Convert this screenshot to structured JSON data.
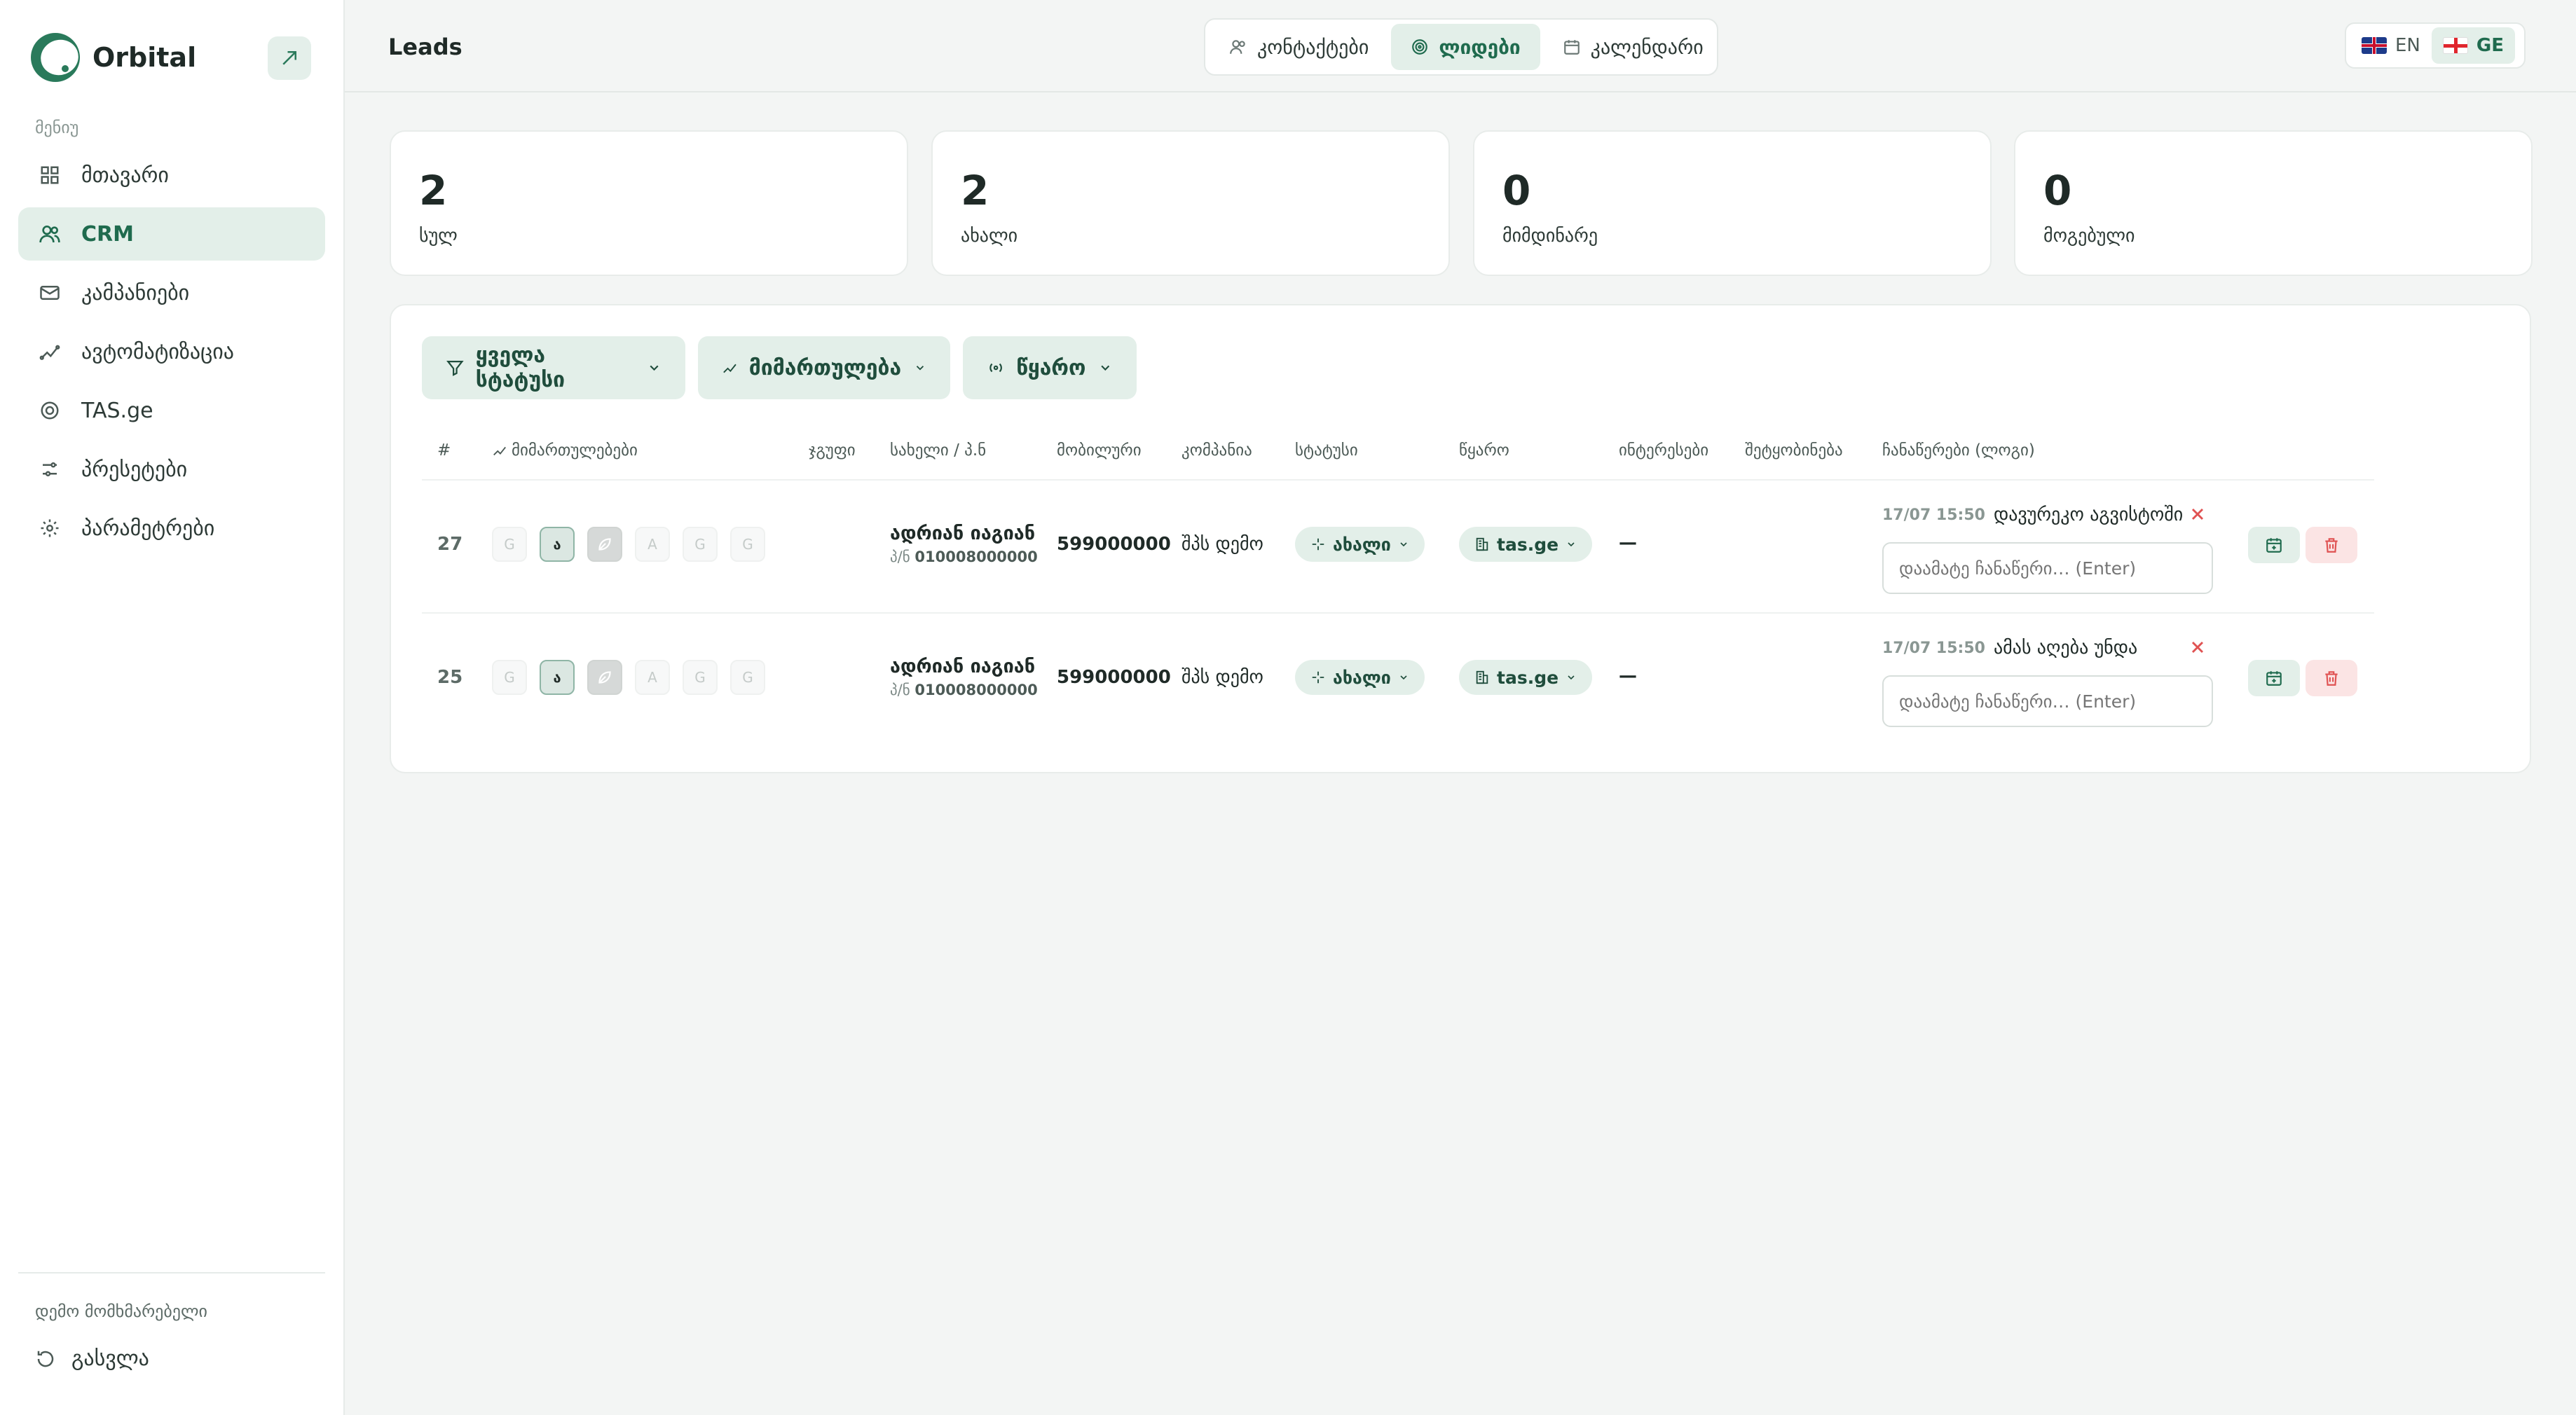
{
  "brand": {
    "name": "Orbital"
  },
  "sidebar": {
    "menu_label": "მენიუ",
    "items": [
      {
        "label": "მთავარი",
        "icon": "grid-icon",
        "active": false
      },
      {
        "label": "CRM",
        "icon": "users-icon",
        "active": true
      },
      {
        "label": "კამპანიები",
        "icon": "mail-icon",
        "active": false
      },
      {
        "label": "ავტომატიზაცია",
        "icon": "trend-icon",
        "active": false
      },
      {
        "label": "TAS.ge",
        "icon": "target-icon",
        "active": false
      },
      {
        "label": "პრესეტები",
        "icon": "sliders-icon",
        "active": false
      },
      {
        "label": "პარამეტრები",
        "icon": "gear-icon",
        "active": false
      }
    ],
    "user": "დემო მომხმარებელი",
    "logout": "გასვლა"
  },
  "header": {
    "title": "Leads",
    "tabs": [
      {
        "label": "კონტაქტები",
        "active": false
      },
      {
        "label": "ლიდები",
        "active": true
      },
      {
        "label": "კალენდარი",
        "active": false
      }
    ],
    "languages": [
      {
        "code": "EN",
        "active": false
      },
      {
        "code": "GE",
        "active": true
      }
    ]
  },
  "stats": [
    {
      "value": "2",
      "label": "სულ"
    },
    {
      "value": "2",
      "label": "ახალი"
    },
    {
      "value": "0",
      "label": "მიმდინარე"
    },
    {
      "value": "0",
      "label": "მოგებული"
    }
  ],
  "filters": {
    "status": "ყველა სტატუსი",
    "direction": "მიმართულება",
    "source": "წყარო"
  },
  "table": {
    "headers": {
      "num": "#",
      "directions": "მიმართულებები",
      "group": "ჯგუფი",
      "name": "სახელი / პ.ნ",
      "mobile": "მობილური",
      "company": "კომპანია",
      "status": "სტატუსი",
      "source": "წყარო",
      "interests": "ინტერესები",
      "messages": "შეტყობინება",
      "notes": "ჩანაწერები (ლოგი)"
    },
    "rows": [
      {
        "num": "27",
        "badges": [
          "G",
          "ა",
          "",
          "A",
          "G",
          "G"
        ],
        "name": "ადრიან იაგიან",
        "pn_prefix": "პ/ნ",
        "pn": "010008000000",
        "mobile": "599000000",
        "company": "შპს დემო",
        "status": "ახალი",
        "source": "tas.ge",
        "interests": "—",
        "note_time": "17/07 15:50",
        "note_text": "დავურეკო აგვისტოში",
        "note_placeholder": "დაამატე ჩანაწერი… (Enter)"
      },
      {
        "num": "25",
        "badges": [
          "G",
          "ა",
          "",
          "A",
          "G",
          "G"
        ],
        "name": "ადრიან იაგიან",
        "pn_prefix": "პ/ნ",
        "pn": "010008000000",
        "mobile": "599000000",
        "company": "შპს დემო",
        "status": "ახალი",
        "source": "tas.ge",
        "interests": "—",
        "note_time": "17/07 15:50",
        "note_text": "ამას აღება უნდა",
        "note_placeholder": "დაამატე ჩანაწერი… (Enter)"
      }
    ]
  },
  "colors": {
    "accent": "#1f6b4e",
    "accent_bg": "#e3efe9",
    "danger": "#e05252",
    "danger_bg": "#fbe4e4"
  }
}
